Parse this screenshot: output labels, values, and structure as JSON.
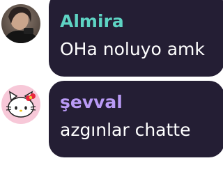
{
  "messages": [
    {
      "author": "Almira",
      "text": "OHa noluyo amk",
      "name_color": "#5ed3c3",
      "avatar_icon": "user-photo-icon"
    },
    {
      "author": "şevval",
      "text": "azgınlar chatte",
      "name_color": "#b99af5",
      "avatar_icon": "hello-kitty-icon"
    }
  ],
  "colors": {
    "bubble": "#241e34",
    "message_text": "#ffffff",
    "background": "#ffffff"
  }
}
